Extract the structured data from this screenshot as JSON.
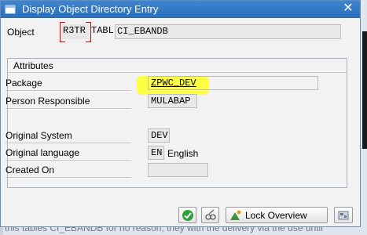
{
  "background": {
    "bottom_text": "this tables CI_EBANDB for no reason, they with the delivery via the use until"
  },
  "dialog": {
    "title": "Display Object Directory Entry",
    "close_symbol": "✕",
    "object": {
      "label": "Object",
      "pgmid": "R3TR",
      "type": "TABL",
      "name": "CI_EBANDB"
    },
    "attributes": {
      "title": "Attributes",
      "package_label": "Package",
      "package_value": "ZPWC_DEV",
      "person_label": "Person Responsible",
      "person_value": "MULABAP",
      "orig_system_label": "Original System",
      "orig_system_value": "DEV",
      "orig_lang_label": "Original language",
      "orig_lang_code": "EN",
      "orig_lang_text": "English",
      "created_on_label": "Created On",
      "created_on_value": ""
    },
    "toolbar": {
      "lock_overview_label": "Lock Overview"
    }
  },
  "colors": {
    "titlebar": "#2a6fbb",
    "highlight": "#ffff3a",
    "bracket": "#dd0000"
  }
}
